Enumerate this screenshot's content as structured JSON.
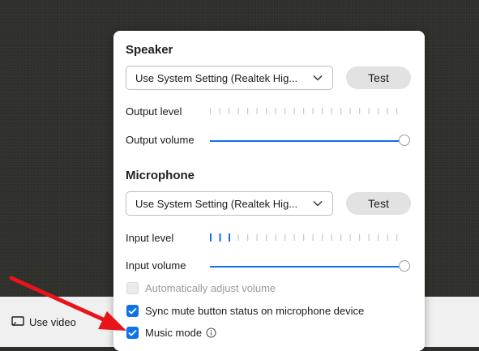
{
  "speaker": {
    "title": "Speaker",
    "device": "Use System Setting (Realtek Hig...",
    "test_label": "Test",
    "output_level_label": "Output level",
    "output_level": 0,
    "output_volume_label": "Output volume",
    "output_volume": 1.0
  },
  "microphone": {
    "title": "Microphone",
    "device": "Use System Setting (Realtek Hig...",
    "test_label": "Test",
    "input_level_label": "Input level",
    "input_level": 0.15,
    "input_volume_label": "Input volume",
    "input_volume": 1.0
  },
  "options": {
    "auto_adjust": {
      "label": "Automatically adjust volume",
      "checked": false,
      "disabled": true
    },
    "sync_mute": {
      "label": "Sync mute button status on microphone device",
      "checked": true
    },
    "music_mode": {
      "label": "Music mode",
      "checked": true
    }
  },
  "video_option": {
    "label": "Use video"
  },
  "colors": {
    "accent": "#0e72ed",
    "annotation_arrow": "#e8141b"
  }
}
